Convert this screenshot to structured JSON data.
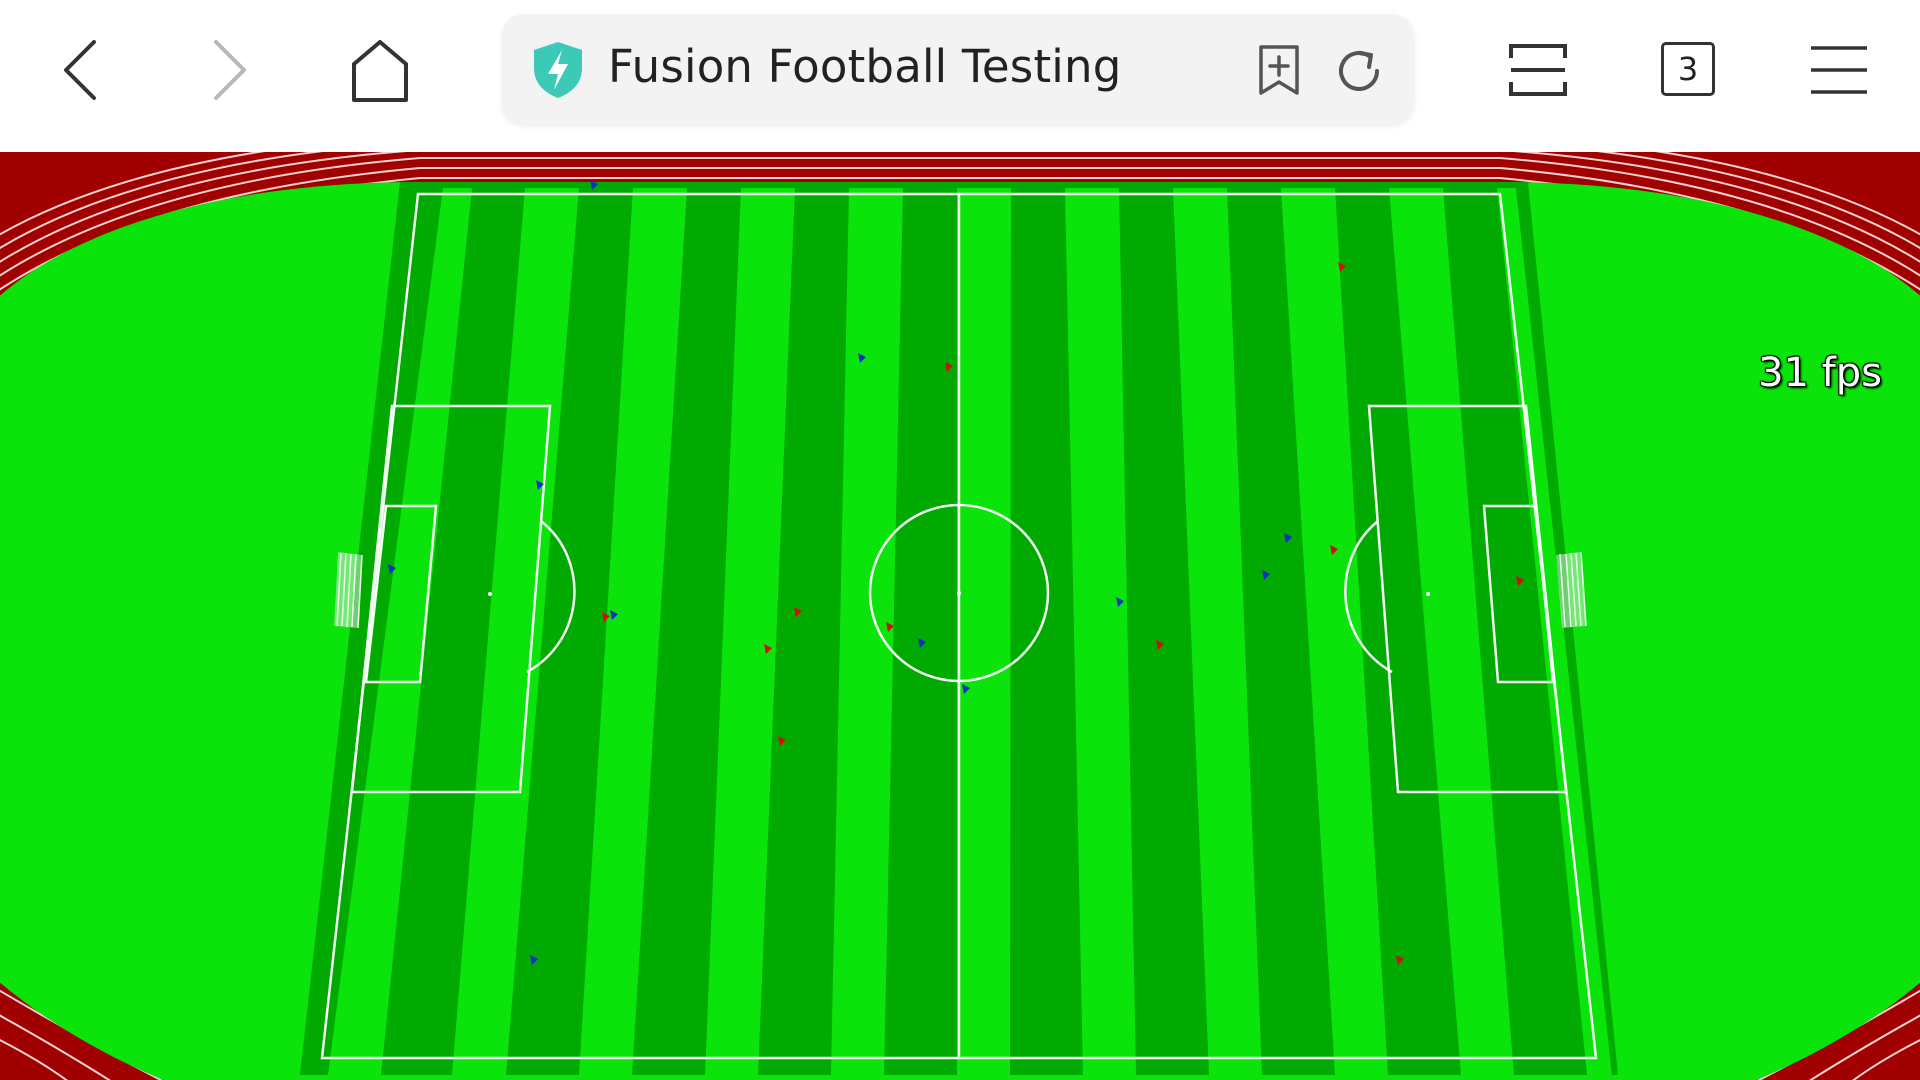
{
  "browser": {
    "page_title": "Fusion Football Testing",
    "tab_count": "3",
    "icons": {
      "back": "chevron-left-icon",
      "forward": "chevron-right-icon",
      "home": "home-icon",
      "security": "shield-bolt-icon",
      "bookmark": "add-bookmark-icon",
      "reload": "reload-icon",
      "layout": "split-view-icon",
      "tabs": "tab-count-icon",
      "menu": "menu-icon"
    },
    "colors": {
      "shield_accent": "#3cc9b8"
    }
  },
  "game": {
    "fps_text": "31 fps",
    "colors": {
      "track": "#a00000",
      "grass_light": "#0ae40a",
      "grass_dark": "#00aa00",
      "lines": "#ffffff",
      "team_blue": "#1030c0",
      "team_red": "#d01010"
    }
  }
}
